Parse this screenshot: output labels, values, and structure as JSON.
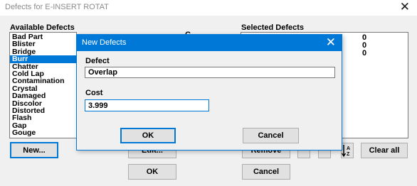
{
  "window": {
    "title": "Defects for E-INSERT ROTAT",
    "close_glyph": "✕"
  },
  "available": {
    "header": "Available Defects",
    "items": [
      "Bad Part",
      "Blister",
      "Bridge",
      "Burr",
      "Chatter",
      "Cold Lap",
      "Contamination",
      "Crystal",
      "Damaged",
      "Discolor",
      "Distorted",
      "Flash",
      "Gap",
      "Gouge"
    ],
    "selected_index": 3
  },
  "middle_header_partial": "C",
  "selected": {
    "header": "Selected Defects",
    "values": [
      "0",
      "0",
      "0"
    ]
  },
  "buttons": {
    "new": "New...",
    "edit_partial": "Edit...",
    "remove_partial": "Remove",
    "clear_all": "Clear all",
    "ok": "OK",
    "cancel": "Cancel"
  },
  "dialog": {
    "title": "New Defects",
    "close_glyph": "✕",
    "defect_label": "Defect",
    "defect_value": "Overlap",
    "cost_label": "Cost",
    "cost_value": "3.999",
    "ok": "OK",
    "cancel": "Cancel"
  },
  "icons": {
    "sort": "sort-az-icon"
  }
}
